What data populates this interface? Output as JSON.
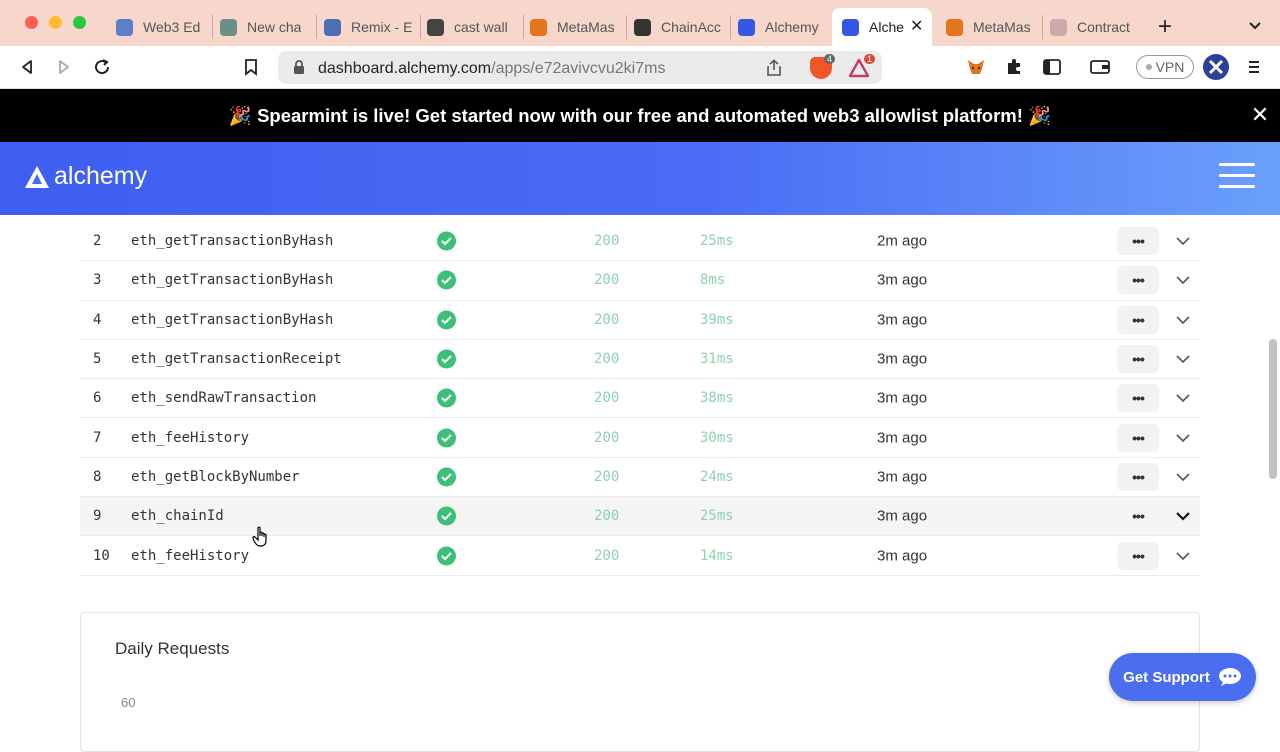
{
  "browser": {
    "tabs": [
      {
        "title": "Web3 Ed",
        "icon": "web3-globe-icon",
        "color": "#5b7fc9"
      },
      {
        "title": "New cha",
        "icon": "openai-icon",
        "color": "#6b8f84"
      },
      {
        "title": "Remix - E",
        "icon": "remix-icon",
        "color": "#4b6fb0"
      },
      {
        "title": "cast wall",
        "icon": "foundry-icon",
        "color": "#444444"
      },
      {
        "title": "MetaMas",
        "icon": "metamask-fox-icon",
        "color": "#e2761b"
      },
      {
        "title": "ChainAcc",
        "icon": "github-icon",
        "color": "#333333"
      },
      {
        "title": "Alchemy",
        "icon": "alchemy-icon",
        "color": "#3656e8"
      },
      {
        "title": "Alche",
        "icon": "alchemy-icon",
        "color": "#3656e8",
        "active": true
      },
      {
        "title": "MetaMas",
        "icon": "metamask-fox-icon",
        "color": "#e2761b"
      },
      {
        "title": "Contract",
        "icon": "contract-icon",
        "color": "#caa"
      }
    ],
    "url_domain": "dashboard.alchemy.com",
    "url_path": "/apps/e72avivcvu2ki7ms",
    "brave_shield_count": "4",
    "rewards_count": "1",
    "vpn_label": "VPN"
  },
  "banner": {
    "text": "🎉 Spearmint is live! Get started now with our free and automated web3 allowlist platform! 🎉"
  },
  "header": {
    "logo_text": "alchemy"
  },
  "requests": [
    {
      "num": "2",
      "method": "eth_getTransactionByHash",
      "code": "200",
      "time": "25ms",
      "ago": "2m ago"
    },
    {
      "num": "3",
      "method": "eth_getTransactionByHash",
      "code": "200",
      "time": "8ms",
      "ago": "3m ago"
    },
    {
      "num": "4",
      "method": "eth_getTransactionByHash",
      "code": "200",
      "time": "39ms",
      "ago": "3m ago"
    },
    {
      "num": "5",
      "method": "eth_getTransactionReceipt",
      "code": "200",
      "time": "31ms",
      "ago": "3m ago"
    },
    {
      "num": "6",
      "method": "eth_sendRawTransaction",
      "code": "200",
      "time": "38ms",
      "ago": "3m ago"
    },
    {
      "num": "7",
      "method": "eth_feeHistory",
      "code": "200",
      "time": "30ms",
      "ago": "3m ago"
    },
    {
      "num": "8",
      "method": "eth_getBlockByNumber",
      "code": "200",
      "time": "24ms",
      "ago": "3m ago"
    },
    {
      "num": "9",
      "method": "eth_chainId",
      "code": "200",
      "time": "25ms",
      "ago": "3m ago",
      "highlighted": true
    },
    {
      "num": "10",
      "method": "eth_feeHistory",
      "code": "200",
      "time": "14ms",
      "ago": "3m ago"
    }
  ],
  "more_label": "•••",
  "daily": {
    "title": "Daily Requests",
    "y_tick": "60"
  },
  "support": {
    "label": "Get Support"
  },
  "colors": {
    "banner_bg": "#000000",
    "header_gradient_start": "#3e5ef0",
    "header_gradient_end": "#6aa0fb",
    "success": "#3fc07a",
    "status_text": "#8ed1ae",
    "support_bg": "#4b6ef0"
  }
}
